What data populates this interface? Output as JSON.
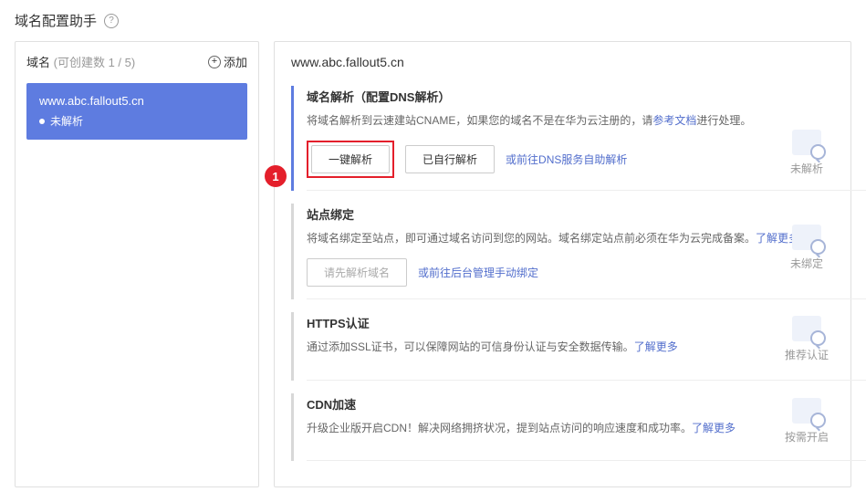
{
  "header": {
    "title": "域名配置助手"
  },
  "sidebar": {
    "label": "域名",
    "count": "(可创建数 1 / 5)",
    "add_label": "添加",
    "domain": {
      "title": "www.abc.fallout5.cn",
      "status": "未解析"
    }
  },
  "main": {
    "title": "www.abc.fallout5.cn",
    "callout": "1",
    "sections": [
      {
        "title": "域名解析（配置DNS解析）",
        "desc_pre": "将域名解析到云速建站CNAME，如果您的域名不是在华为云注册的，请",
        "desc_link": "参考文档",
        "desc_post": "进行处理。",
        "btn1": "一键解析",
        "btn2": "已自行解析",
        "link": "或前往DNS服务自助解析",
        "status": "未解析"
      },
      {
        "title": "站点绑定",
        "desc_pre": "将域名绑定至站点，即可通过域名访问到您的网站。域名绑定站点前必须在华为云完成备案。",
        "desc_link": "了解更多",
        "btn1": "请先解析域名",
        "link": "或前往后台管理手动绑定",
        "status": "未绑定"
      },
      {
        "title": "HTTPS认证",
        "desc_pre": "通过添加SSL证书，可以保障网站的可信身份认证与安全数据传输。",
        "desc_link": "了解更多",
        "status": "推荐认证"
      },
      {
        "title": "CDN加速",
        "desc_pre": "升级企业版开启CDN！解决网络拥挤状况，提到站点访问的响应速度和成功率。",
        "desc_link": "了解更多",
        "status": "按需开启"
      }
    ]
  }
}
